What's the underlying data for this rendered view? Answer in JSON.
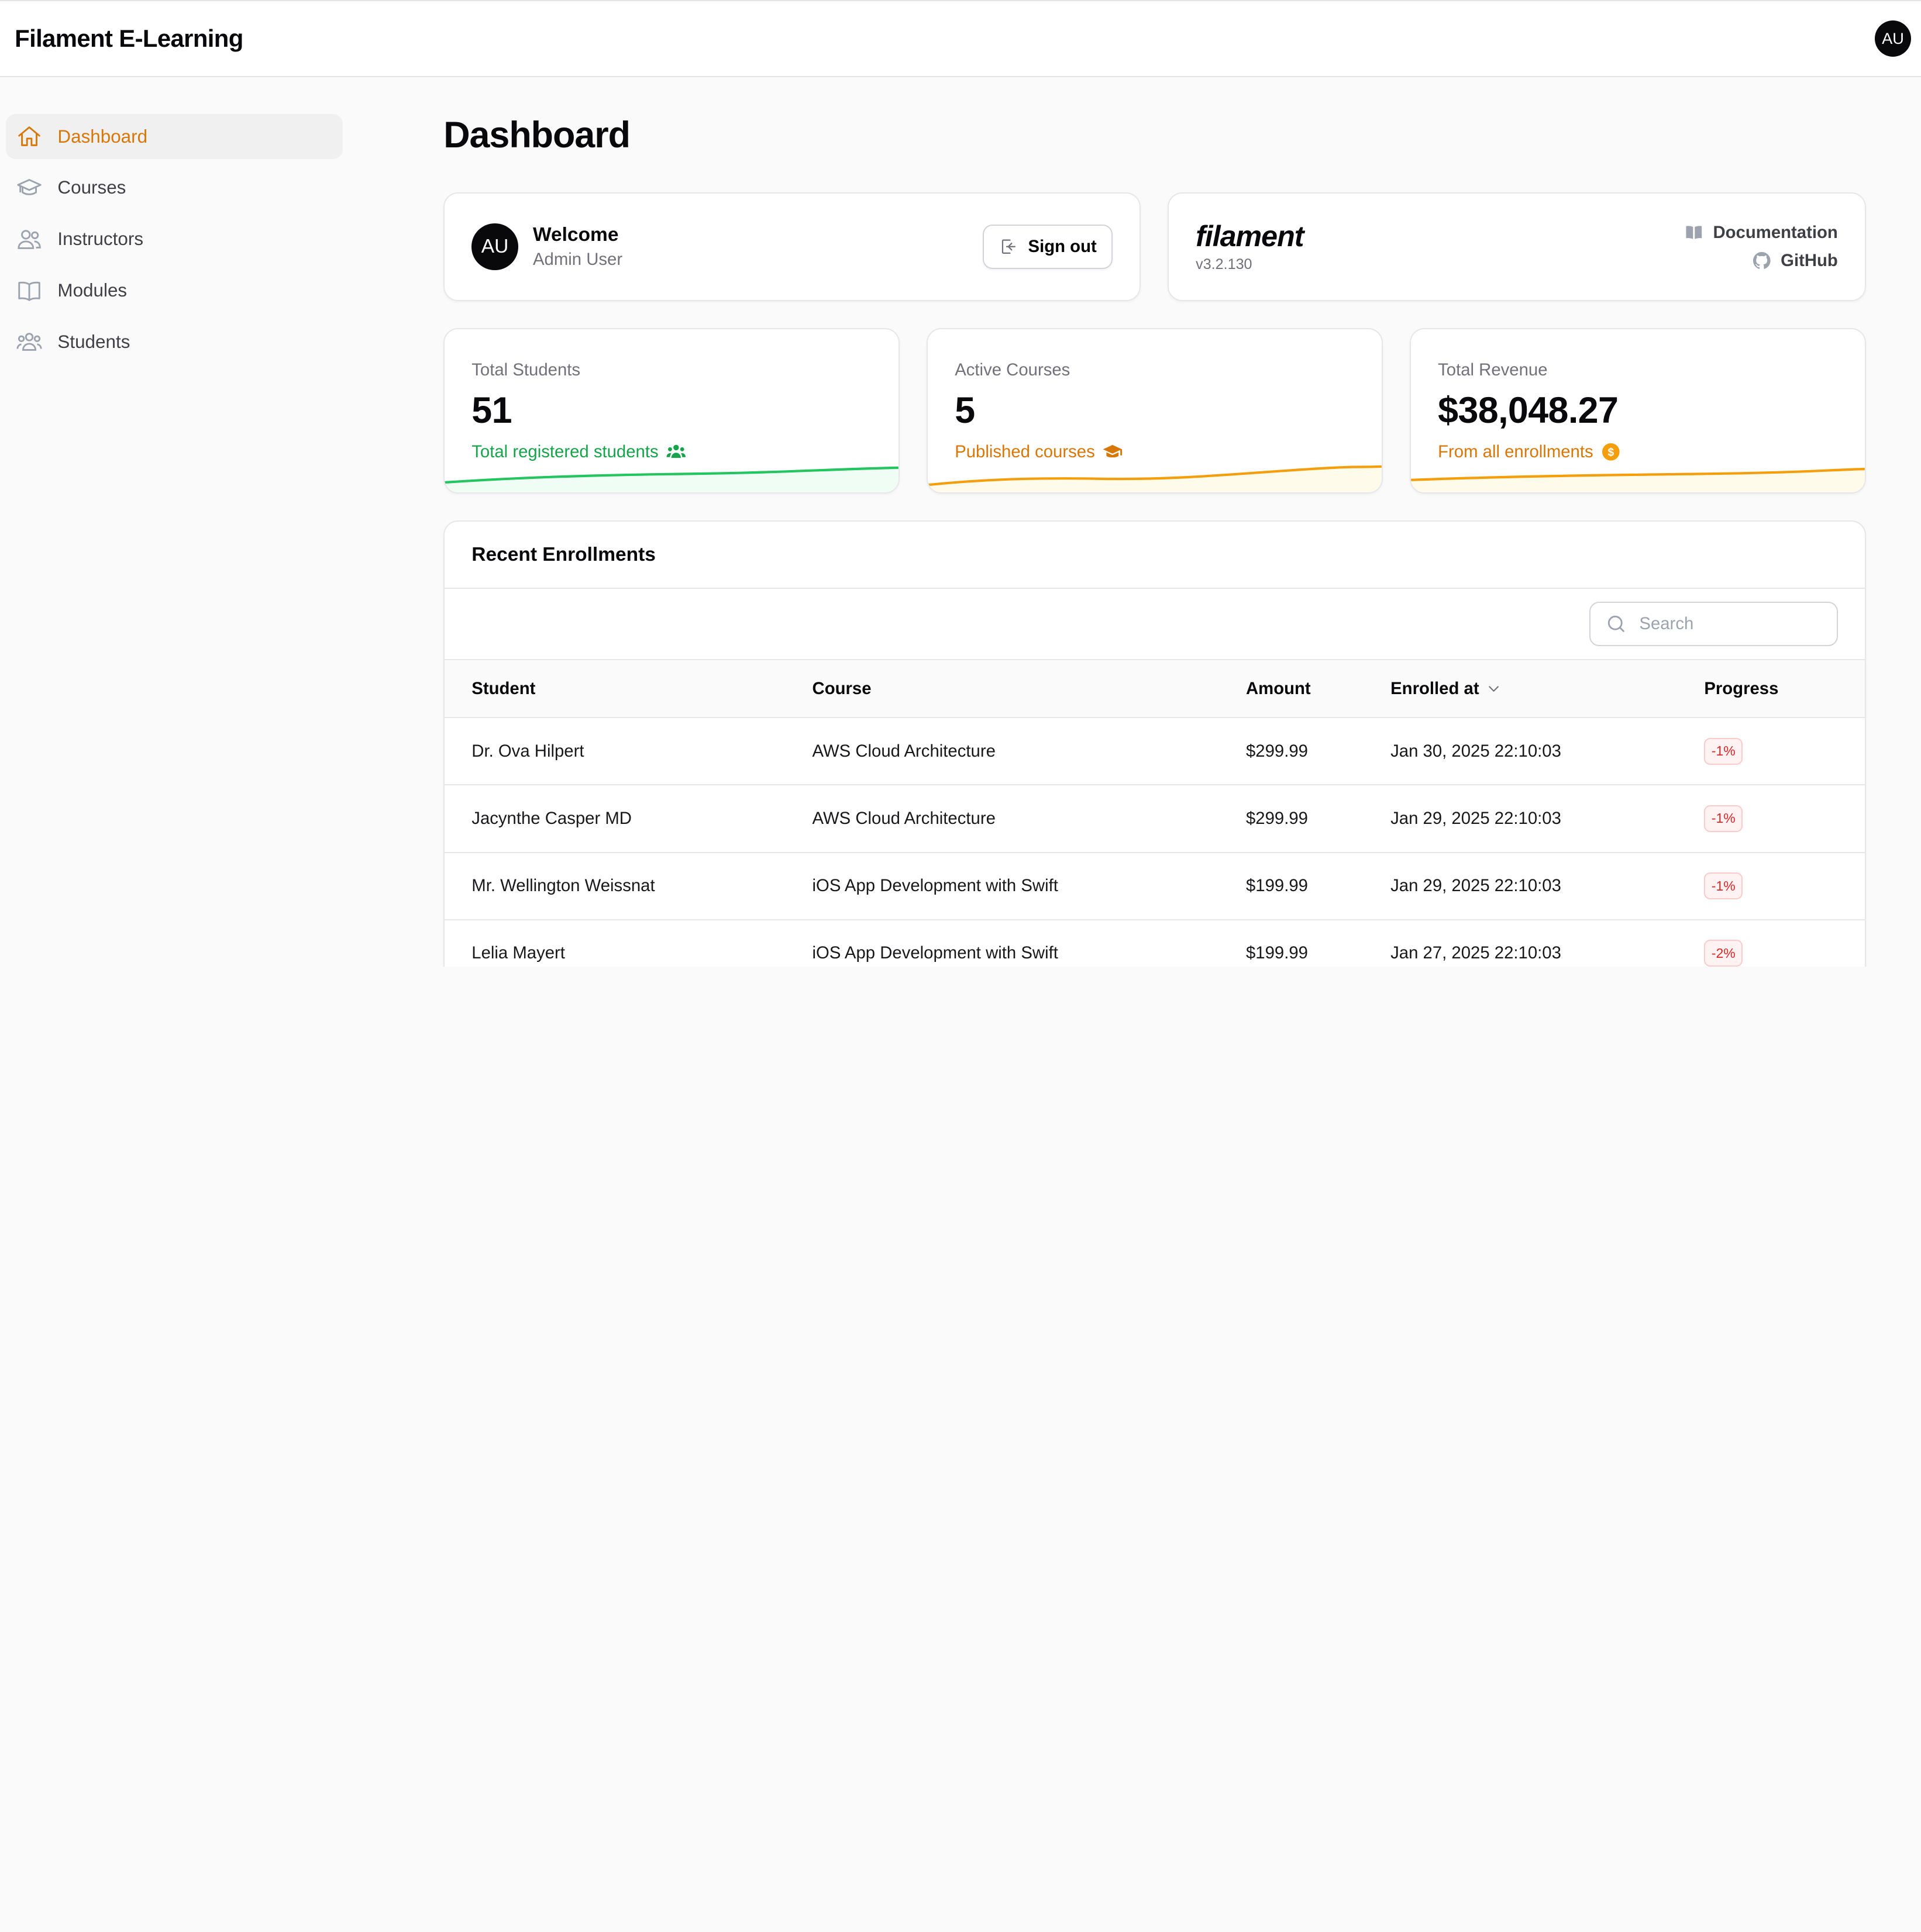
{
  "app": {
    "title": "Filament E-Learning",
    "user_initials": "AU"
  },
  "sidebar": {
    "items": [
      {
        "label": "Dashboard",
        "icon": "home-icon",
        "active": true
      },
      {
        "label": "Courses",
        "icon": "academic-cap-icon",
        "active": false
      },
      {
        "label": "Instructors",
        "icon": "users-icon",
        "active": false
      },
      {
        "label": "Modules",
        "icon": "book-open-icon",
        "active": false
      },
      {
        "label": "Students",
        "icon": "user-group-icon",
        "active": false
      }
    ]
  },
  "page": {
    "title": "Dashboard"
  },
  "welcome": {
    "initials": "AU",
    "title": "Welcome",
    "user_name": "Admin User",
    "sign_out_label": "Sign out"
  },
  "filament_info": {
    "logo_text": "filament",
    "version": "v3.2.130",
    "documentation_label": "Documentation",
    "github_label": "GitHub"
  },
  "stats": [
    {
      "label": "Total Students",
      "value": "51",
      "description": "Total registered students",
      "color": "#16a34a"
    },
    {
      "label": "Active Courses",
      "value": "5",
      "description": "Published courses",
      "color": "#d97706"
    },
    {
      "label": "Total Revenue",
      "value": "$38,048.27",
      "description": "From all enrollments",
      "color": "#d97706"
    }
  ],
  "enrollments": {
    "title": "Recent Enrollments",
    "search_placeholder": "Search",
    "columns": [
      "Student",
      "Course",
      "Amount",
      "Enrolled at",
      "Progress"
    ],
    "rows": [
      {
        "student": "Dr. Ova Hilpert",
        "course": "AWS Cloud Architecture",
        "amount": "$299.99",
        "enrolled_at": "Jan 30, 2025 22:10:03",
        "progress": "-1%"
      },
      {
        "student": "Jacynthe Casper MD",
        "course": "AWS Cloud Architecture",
        "amount": "$299.99",
        "enrolled_at": "Jan 29, 2025 22:10:03",
        "progress": "-1%"
      },
      {
        "student": "Mr. Wellington Weissnat",
        "course": "iOS App Development with Swift",
        "amount": "$199.99",
        "enrolled_at": "Jan 29, 2025 22:10:03",
        "progress": "-1%"
      },
      {
        "student": "Lelia Mayert",
        "course": "iOS App Development with Swift",
        "amount": "$199.99",
        "enrolled_at": "Jan 27, 2025 22:10:03",
        "progress": "-2%"
      }
    ]
  },
  "colors": {
    "accent": "#d97706",
    "success": "#16a34a",
    "danger": "#dc2626"
  }
}
